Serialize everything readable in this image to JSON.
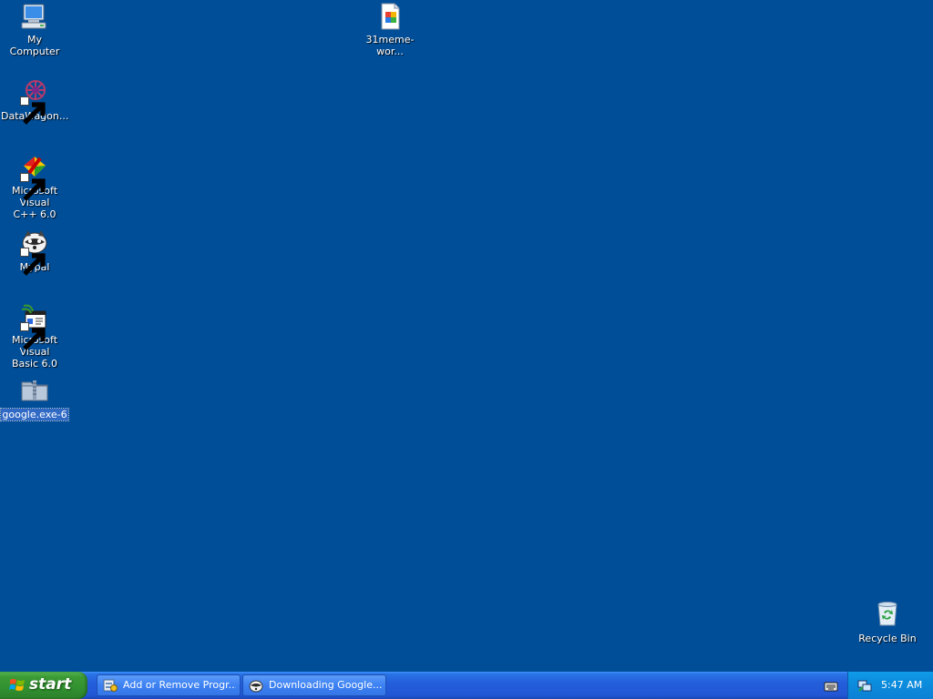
{
  "desktop": {
    "background_color": "#004e98",
    "icons": [
      {
        "label": "My Computer",
        "icon": "my-computer-icon"
      },
      {
        "label": "DataWagon...",
        "icon": "datawagon-icon"
      },
      {
        "label": "Microsoft Visual\nC++ 6.0",
        "icon": "visual-cpp-icon"
      },
      {
        "label": "Mypal",
        "icon": "mypal-icon"
      },
      {
        "label": "Microsoft Visual\nBasic 6.0",
        "icon": "visual-basic-icon"
      },
      {
        "label": "google.exe-6",
        "icon": "zip-folder-icon"
      },
      {
        "label": "31meme-wor...",
        "icon": "document-icon"
      },
      {
        "label": "Recycle Bin",
        "icon": "recycle-bin-icon"
      }
    ]
  },
  "taskbar": {
    "start_label": "start",
    "tasks": [
      {
        "label": "Add or Remove Progr...",
        "icon": "add-remove-programs-icon"
      },
      {
        "label": "Downloading Google....",
        "icon": "mypal-icon"
      }
    ],
    "clock": "5:47 AM"
  }
}
